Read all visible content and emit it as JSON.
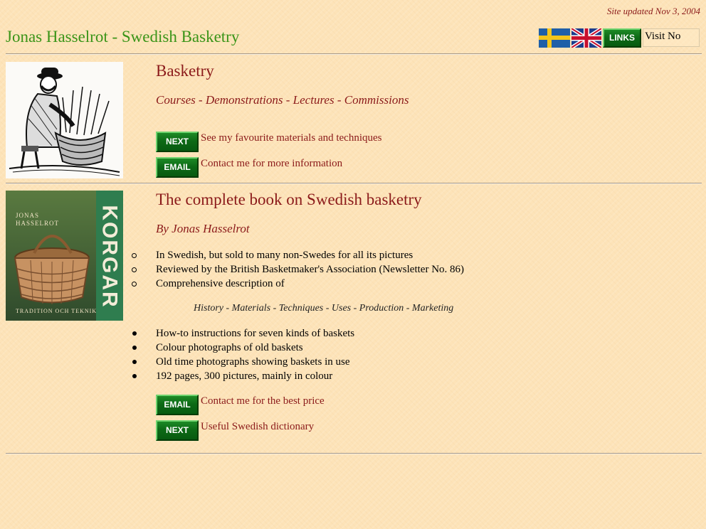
{
  "header": {
    "updated": "Site updated Nov 3, 2004",
    "site_title": "Jonas Hasselrot - Swedish Basketry",
    "links_label": "LINKS",
    "visit_text": "Visit No"
  },
  "section1": {
    "heading": "Basketry",
    "subheading": "Courses - Demonstrations - Lectures - Commissions",
    "next_label": "NEXT",
    "next_link": "See my favourite materials and techniques",
    "email_label": "EMAIL",
    "email_link": "Contact me for more information"
  },
  "section2": {
    "heading": "The complete book on Swedish basketry",
    "author": "By Jonas Hasselrot",
    "book_cover": {
      "title": "KORGAR",
      "author_line1": "JONAS",
      "author_line2": "HASSELROT",
      "subtitle": "TRADITION OCH TEKNIK"
    },
    "bullets_circle": [
      "In Swedish, but sold to many non-Swedes for all its pictures",
      "Reviewed by the British Basketmaker's Association (Newsletter No. 86)",
      "Comprehensive description of"
    ],
    "topics": "History - Materials - Techniques - Uses - Production - Marketing",
    "bullets_disc": [
      "How-to instructions for seven kinds of baskets",
      "Colour photographs of old baskets",
      "Old time photographs showing baskets in use",
      "192 pages, 300 pictures, mainly in colour"
    ],
    "email_label": "EMAIL",
    "email_link": "Contact me for the best price",
    "next_label": "NEXT",
    "next_link": "Useful Swedish dictionary"
  },
  "colors": {
    "background": "#fde3b8",
    "title_green": "#3a9418",
    "text_red": "#8b1a1a",
    "button_green": "#0d6a16"
  },
  "icons": [
    "swedish-flag-icon",
    "uk-flag-icon"
  ]
}
